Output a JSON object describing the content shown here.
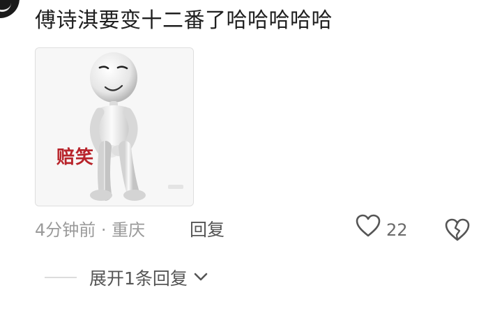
{
  "comment": {
    "text": "傅诗淇要变十二番了哈哈哈哈哈",
    "sticker": {
      "caption": "赔笑",
      "caption_color": "#b8232a",
      "icon": "smiling-3d-figure"
    }
  },
  "meta": {
    "time_location": "4分钟前 · 重庆",
    "reply_label": "回复",
    "like_count": "22"
  },
  "replies": {
    "expand_label": "展开1条回复"
  },
  "icons": {
    "like": "heart-outline-icon",
    "dislike": "broken-heart-icon",
    "expand": "chevron-down-icon"
  }
}
